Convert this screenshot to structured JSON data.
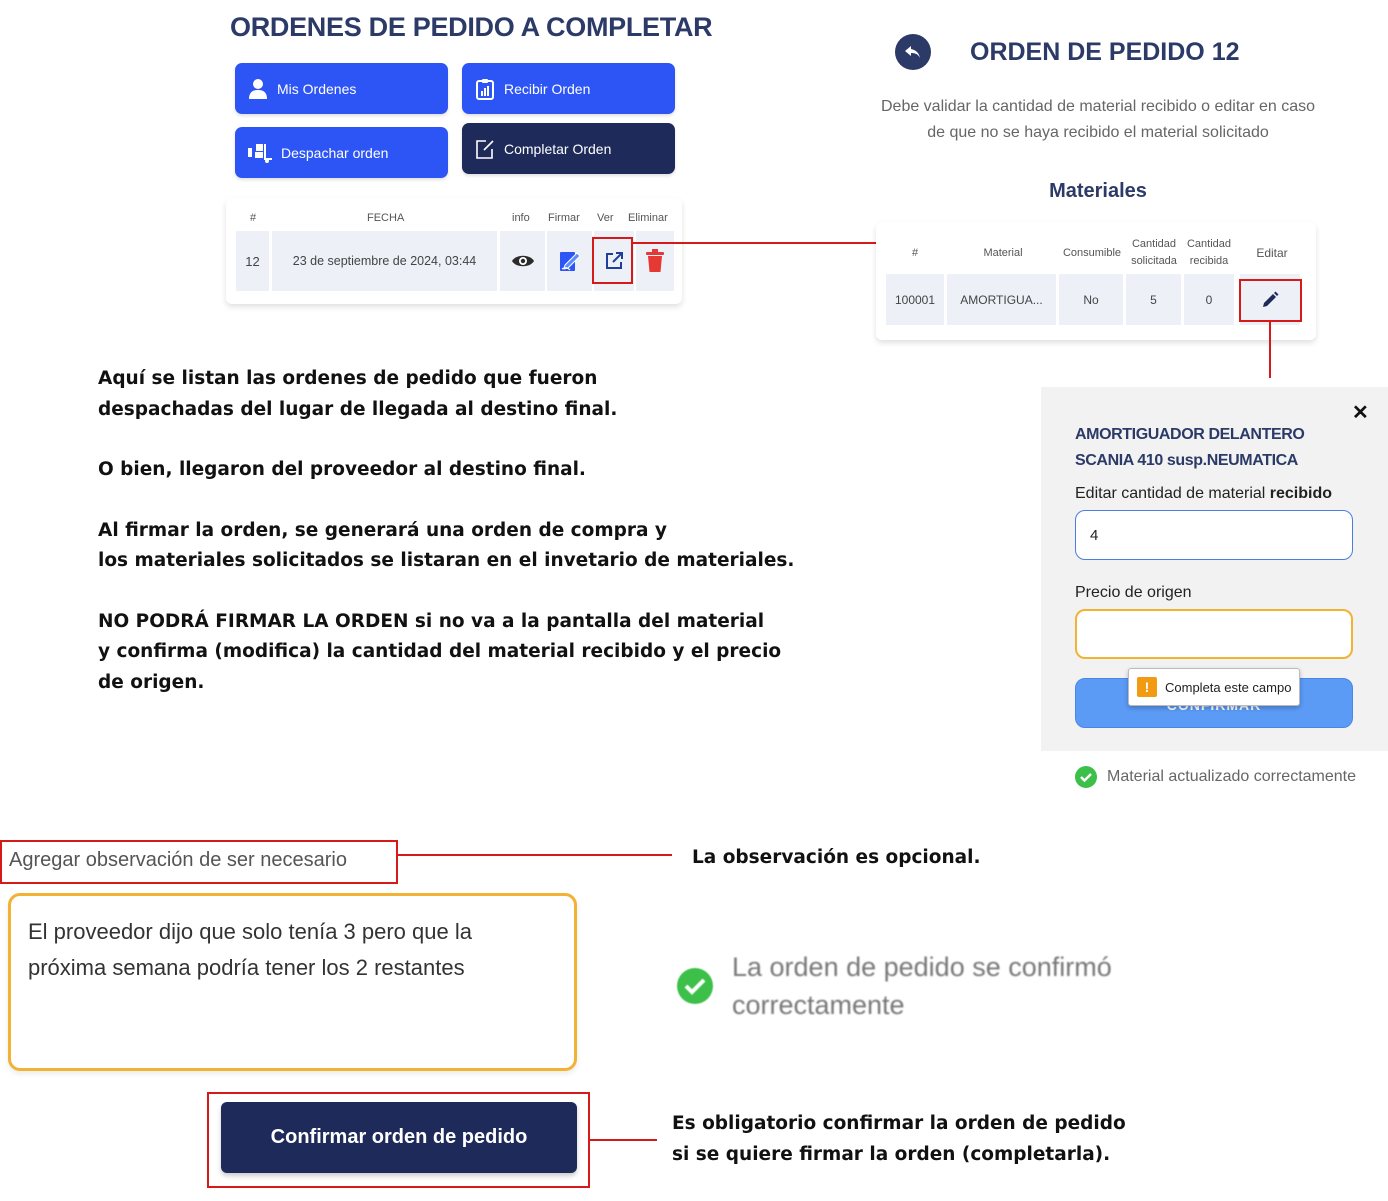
{
  "orders_panel": {
    "title": "ORDENES DE PEDIDO A COMPLETAR",
    "buttons": {
      "mis_ordenes": "Mis Ordenes",
      "recibir_orden": "Recibir Orden",
      "despachar_orden": "Despachar orden",
      "completar_orden": "Completar Orden"
    },
    "table": {
      "headers": [
        "#",
        "FECHA",
        "info",
        "Firmar",
        "Ver",
        "Eliminar"
      ],
      "rows": [
        {
          "id": "12",
          "fecha": "23 de septiembre de 2024, 03:44",
          "info_icon": "eye-icon",
          "firmar_icon": "sign-document-icon",
          "ver_icon": "external-link-icon",
          "eliminar_icon": "trash-icon"
        }
      ]
    }
  },
  "order_detail": {
    "title": "ORDEN DE PEDIDO 12",
    "description": "Debe validar la cantidad de material recibido o editar en caso de que no se haya recibido el material solicitado",
    "subtitle": "Materiales",
    "table": {
      "headers": [
        "#",
        "Material",
        "Consumible",
        "Cantidad solicitada",
        "Cantidad recibida",
        "Editar"
      ],
      "rows": [
        {
          "id": "100001",
          "material": "AMORTIGUA...",
          "consumible": "No",
          "cantidad_solicitada": "5",
          "cantidad_recibida": "0",
          "editar_icon": "pencil-icon"
        }
      ]
    }
  },
  "edit_modal": {
    "title": "AMORTIGUADOR DELANTERO SCANIA 410 susp.NEUMATICA",
    "qty_label_prefix": "Editar cantidad de material ",
    "qty_label_bold": "recibido",
    "qty_value": "4",
    "price_label": "Precio de origen",
    "price_value": "",
    "confirm_label": "CONFIRMAR",
    "tooltip": "Completa este campo",
    "success_toast": "Material actualizado correctamente"
  },
  "explanation": {
    "p1_line1": "Aquí se listan las ordenes de pedido que fueron",
    "p1_line2": "despachadas del lugar de llegada al destino final.",
    "p2": "O bien, llegaron del proveedor al destino final.",
    "p3_line1": "Al firmar la orden, se generará una orden de compra y",
    "p3_line2": "los materiales solicitados se listaran en el invetario de materiales.",
    "p4_line1": "NO PODRÁ FIRMAR LA ORDEN si no va a la pantalla del material",
    "p4_line2": "y confirma (modifica) la cantidad del material recibido y el precio",
    "p4_line3": "de origen."
  },
  "observation": {
    "label": "Agregar observación de ser necesario",
    "text_line1": "El proveedor dijo que solo tenía 3 pero que la",
    "text_line2": "próxima semana podría tener los 2 restantes",
    "note": "La observación es opcional."
  },
  "order_confirmed_toast": {
    "line1": "La orden de pedido se confirmó",
    "line2": "correctamente"
  },
  "confirm_order": {
    "button": "Confirmar orden de pedido",
    "note_line1": "Es obligatorio confirmar la orden de pedido",
    "note_line2": "si se quiere firmar la orden (completarla)."
  },
  "colors": {
    "primary_blue": "#2d55f5",
    "navy": "#2b3a67",
    "dark_button": "#1e2a5a",
    "annotation_red": "#d61a1a",
    "success_green": "#3cc04a",
    "delete_red": "#e53935",
    "input_focus_blue": "#4a7de0",
    "input_warning_amber": "#f2b234"
  }
}
